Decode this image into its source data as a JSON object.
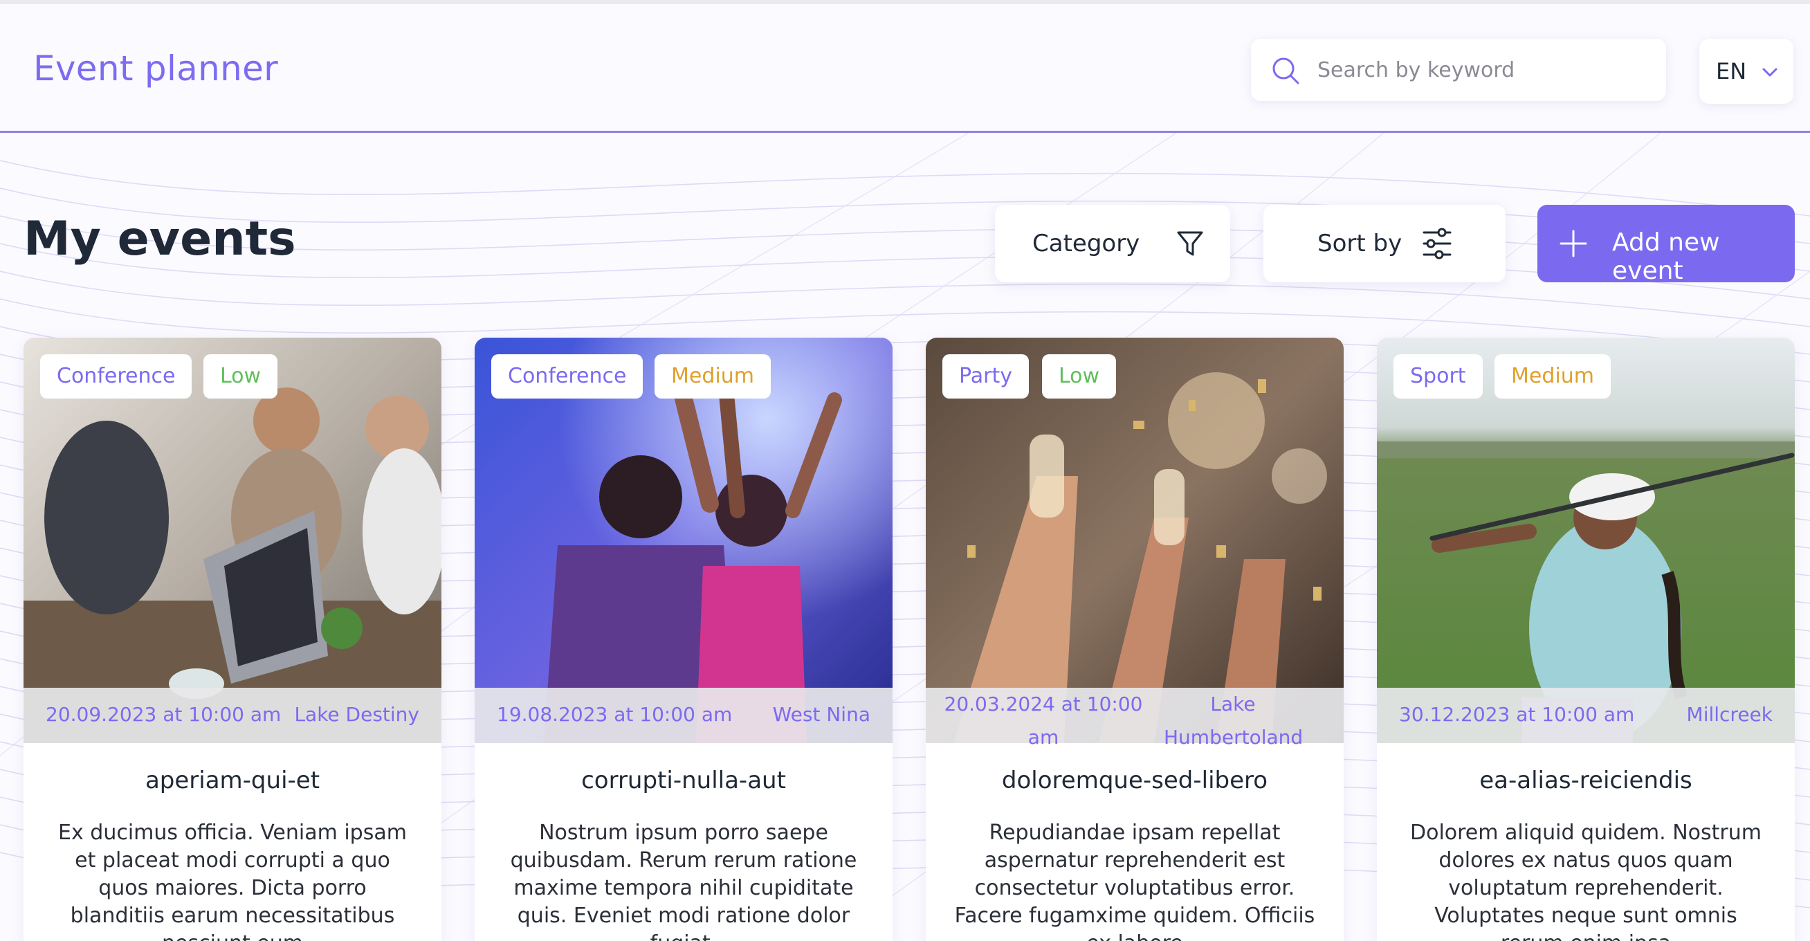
{
  "header": {
    "logo": "Event planner",
    "search": {
      "placeholder": "Search by keyword",
      "value": ""
    },
    "language": {
      "selected": "EN"
    }
  },
  "page": {
    "title": "My events"
  },
  "toolbar": {
    "category_label": "Category",
    "sort_label": "Sort by",
    "add_label": "Add new event"
  },
  "colors": {
    "accent": "#7b6af0",
    "priority_low": "#5fbf5a",
    "priority_medium": "#e0a02a"
  },
  "events": [
    {
      "category": "Conference",
      "priority": "Low",
      "date": "20.09.2023 at 10:00 am",
      "location": "Lake Destiny",
      "title": "aperiam-qui-et",
      "description": "Ex ducimus officia. Veniam ipsam et placeat modi corrupti a quo quos maiores. Dicta porro blanditiis earum necessitatibus nesciunt eum"
    },
    {
      "category": "Conference",
      "priority": "Medium",
      "date": "19.08.2023 at 10:00 am",
      "location": "West Nina",
      "title": "corrupti-nulla-aut",
      "description": "Nostrum ipsum porro saepe quibusdam. Rerum rerum ratione maxime tempora nihil cupiditate quis. Eveniet modi ratione dolor fugiat."
    },
    {
      "category": "Party",
      "priority": "Low",
      "date": "20.03.2024 at 10:00 am",
      "location": "Lake Humbertoland",
      "title": "doloremque-sed-libero",
      "description": "Repudiandae ipsam repellat aspernatur reprehenderit est consectetur voluptatibus error. Facere fugamxime quidem. Officiis ex labore"
    },
    {
      "category": "Sport",
      "priority": "Medium",
      "date": "30.12.2023 at 10:00 am",
      "location": "Millcreek",
      "title": "ea-alias-reiciendis",
      "description": "Dolorem aliquid quidem. Nostrum dolores ex natus quos quam voluptatum reprehenderit. Voluptates neque sunt omnis rerum enim ipsa"
    }
  ]
}
